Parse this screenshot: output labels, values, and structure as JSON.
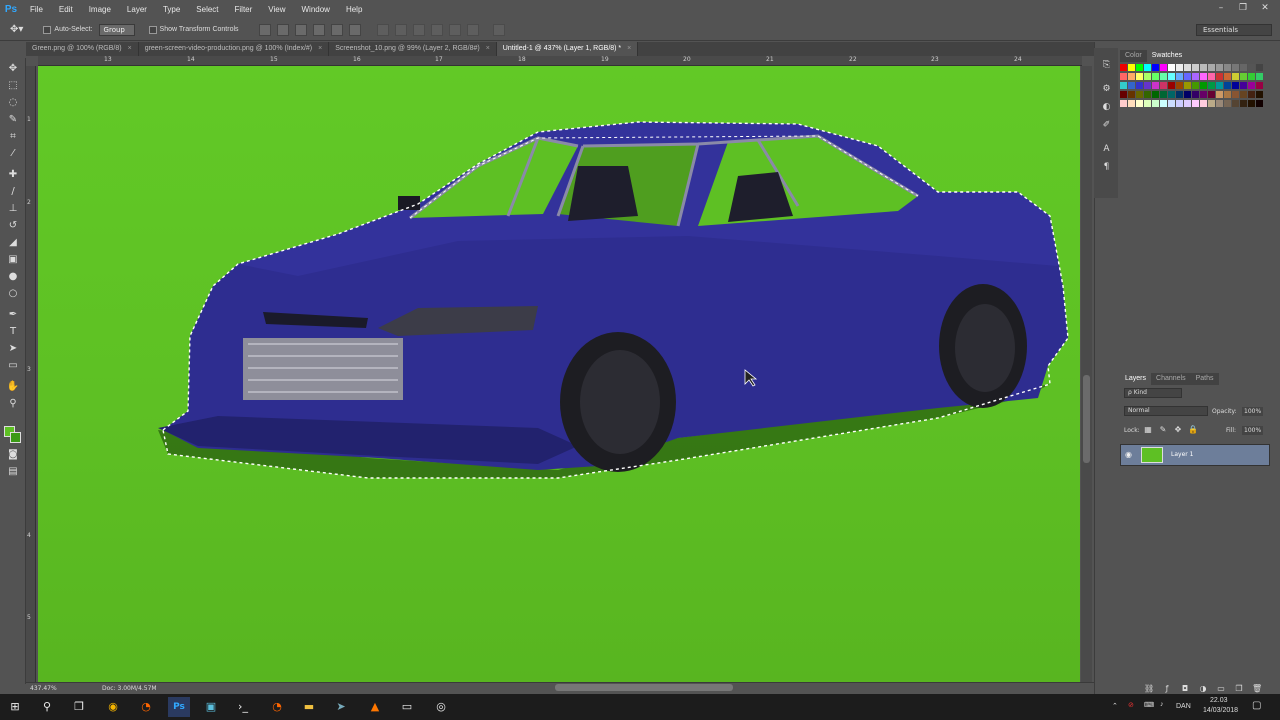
{
  "app": {
    "logo": "Ps"
  },
  "menu": [
    "File",
    "Edit",
    "Image",
    "Layer",
    "Type",
    "Select",
    "Filter",
    "View",
    "Window",
    "Help"
  ],
  "window_controls": {
    "minimize": "–",
    "restore": "❐",
    "close": "✕"
  },
  "options": {
    "auto_select_label": "Auto-Select:",
    "auto_select_value": "Group",
    "transform_label": "Show Transform Controls",
    "workspace": "Essentials"
  },
  "doc_tabs": [
    {
      "label": "Green.png @ 100% (RGB/8)",
      "close": "×",
      "active": false
    },
    {
      "label": "green-screen-video-production.png @ 100% (Index/#)",
      "close": "×",
      "active": false
    },
    {
      "label": "Screenshot_10.png @ 99% (Layer 2, RGB/8#)",
      "close": "×",
      "active": false
    },
    {
      "label": "Untitled-1 @ 437% (Layer 1, RGB/8) *",
      "close": "×",
      "active": true
    }
  ],
  "ruler_top": [
    "13",
    "14",
    "15",
    "16",
    "17",
    "18",
    "19",
    "20",
    "21",
    "22",
    "23",
    "24"
  ],
  "ruler_left": [
    "1",
    "2",
    "3",
    "4",
    "5"
  ],
  "status": {
    "zoom": "437.47%",
    "doc": "Doc: 3.00M/4.57M"
  },
  "panels": {
    "color_tab": "Color",
    "swatches_tab": "Swatches",
    "layers_tab": "Layers",
    "channels_tab": "Channels",
    "paths_tab": "Paths",
    "kind_label": "ρ Kind",
    "blend_mode": "Normal",
    "opacity_label": "Opacity:",
    "opacity_value": "100%",
    "lock_label": "Lock:",
    "fill_label": "Fill:",
    "fill_value": "100%",
    "layer_name": "Layer 1"
  },
  "taskbar": {
    "language": "DAN",
    "time": "22.03",
    "date": "14/03/2018"
  },
  "colors": {
    "canvas_green": "#5ec024",
    "car_blue": "#2c2b8c",
    "layer_selected": "#6d7e9a",
    "ps_blue": "#31a8ff"
  }
}
